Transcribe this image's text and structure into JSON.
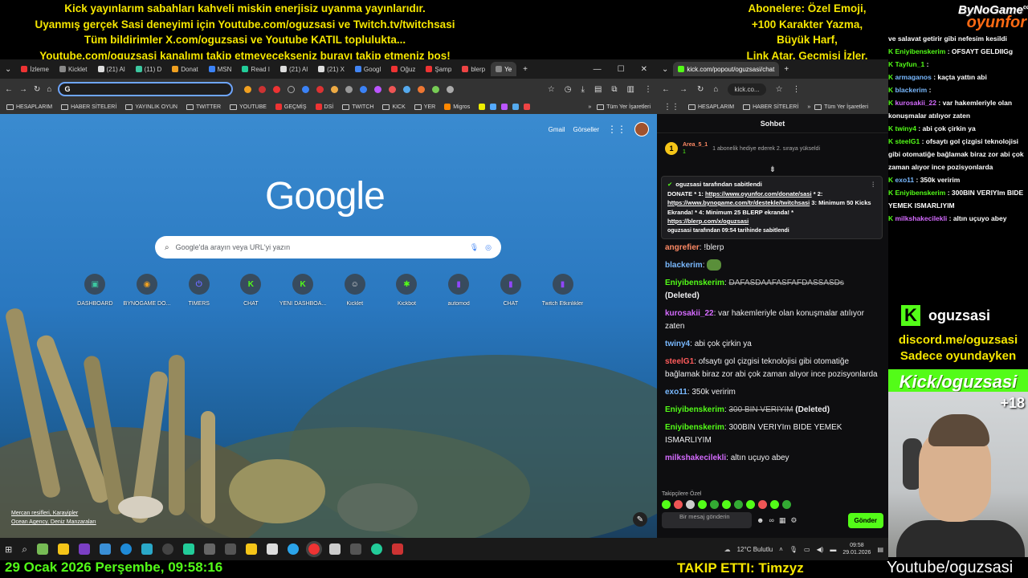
{
  "overlay_top": {
    "lines": [
      "Kick yayınlarım sabahları kahveli miskin enerjisiz uyanma yayınlarıdır.",
      "Uyanmış gerçek Sasi deneyimi için Youtube.com/oguzsasi ve Twitch.tv/twitchsasi",
      "Tüm bildirimler X.com/oguzsasi ve Youtube KATIL toplulukta...",
      "Youtube.com/oguzsasi kanalımı takip etmeyecekseniz burayı takip etmeniz boş!"
    ],
    "right_lines": [
      "Abonelere: Özel Emoji,",
      "+100 Karakter Yazma,",
      "Büyük Harf,",
      "Link Atar, Geçmişi İzler."
    ]
  },
  "brand": {
    "line1": "ByNoGame",
    "line2": "oyunfor",
    "suffix": "com"
  },
  "browser_main": {
    "tabs": [
      "İzleme",
      "Kicklet",
      "(21) Al",
      "(11) D",
      "Donat",
      "MSN",
      "Read I",
      "(21) Al",
      "(21) X",
      "Googl",
      "Oğuz",
      "Şamp",
      "blerp",
      "Ye"
    ],
    "address": "G",
    "bookmarks": [
      "HESAPLARIM",
      "HABER SİTELERİ",
      "YAYINLIK OYUN",
      "TWITTER",
      "YOUTUBE",
      "GEÇMİŞ",
      "DSİ",
      "TWITCH",
      "KICK",
      "YER",
      "Migros",
      "Tüm Yer İşaretleri"
    ],
    "top_links": [
      "Gmail",
      "Görseller"
    ],
    "logo": "Google",
    "search_placeholder": "Google'da arayın veya URL'yi yazın",
    "shortcuts": [
      {
        "label": "DASHBOARD",
        "glyph": "▣",
        "color": "#3cc7a0"
      },
      {
        "label": "BYNOGAME DO...",
        "glyph": "◉",
        "color": "#f0a020"
      },
      {
        "label": "TIMERS",
        "glyph": "⏻",
        "color": "#6b6bff"
      },
      {
        "label": "CHAT",
        "glyph": "K",
        "color": "#53fc18"
      },
      {
        "label": "YENİ DASHBOA...",
        "glyph": "K",
        "color": "#53fc18"
      },
      {
        "label": "Kicklet",
        "glyph": "☺",
        "color": "#ddd"
      },
      {
        "label": "Kickbot",
        "glyph": "✱",
        "color": "#53fc18"
      },
      {
        "label": "automod",
        "glyph": "▮",
        "color": "#9146ff"
      },
      {
        "label": "CHAT",
        "glyph": "▮",
        "color": "#9146ff"
      },
      {
        "label": "Twitch Etkinlikler",
        "glyph": "▮",
        "color": "#9146ff"
      }
    ],
    "credit_line1": "Mercan resifleri, Karayipler",
    "credit_line2": "Ocean Agency, Deniz Manzaraları"
  },
  "browser_chat": {
    "tab": "kick.com/popout/oguzsasi/chat",
    "address": "kick.co...",
    "bookmarks": [
      "HESAPLARIM",
      "HABER SİTELERİ",
      "Tüm Yer İşaretleri"
    ],
    "header": "Sohbet",
    "gift_user": "Area_5_1",
    "gift_count": "1",
    "gift_text": "1 abonelik hediye ederek 2. sıraya yükseldi",
    "pinned_by": "oguzsasi tarafından sabitlendi",
    "pinned_pre": "DONATE * 1: ",
    "pinned_link1": "https://www.oyunfor.com/donate/sasi",
    "pinned_mid1": " * 2: ",
    "pinned_link2": "https://www.bynogame.com/tr/destekle/twitchsasi",
    "pinned_mid2": " 3: Minimum 50 Kicks Ekranda! * 4: Minimum 25 BLERP ekranda! * ",
    "pinned_link3": "https://blerp.com/x/oguzsasi",
    "pinned_footer": "oguzsasi tarafından 09:54 tarihinde sabitlendi",
    "messages": [
      {
        "user": "angrefier",
        "color": "#ff8a65",
        "text": "!blerp",
        "deleted": false
      },
      {
        "user": "blackerim",
        "color": "#79b9ff",
        "text": "",
        "deleted": false
      },
      {
        "user": "Eniyibenskerim",
        "color": "#53fc18",
        "text": "DAFASDAAFASFAFDASSASDs",
        "deleted": true,
        "deleted_label": "(Deleted)"
      },
      {
        "user": "kurosakii_22",
        "color": "#d56bff",
        "text": "var hakemleriyle olan konuşmalar atılıyor zaten",
        "deleted": false
      },
      {
        "user": "twiny4",
        "color": "#79b9ff",
        "text": "abi çok çirkin ya",
        "deleted": false
      },
      {
        "user": "steelG1",
        "color": "#ff5b5b",
        "text": "ofsaytı gol çizgisi teknolojisi gibi otomatiğe bağlamak biraz zor abi çok zaman alıyor ince pozisyonlarda",
        "deleted": false
      },
      {
        "user": "exo11",
        "color": "#79b9ff",
        "text": "350k veririm",
        "deleted": false
      },
      {
        "user": "Eniyibenskerim",
        "color": "#53fc18",
        "text": "300 BIN VERIYIM",
        "deleted": true,
        "deleted_label": "(Deleted)"
      },
      {
        "user": "Eniyibenskerim",
        "color": "#53fc18",
        "text": "300BIN VERIYIm BIDE YEMEK ISMARLIYIM",
        "deleted": false
      },
      {
        "user": "milkshakecilekli",
        "color": "#d56bff",
        "text": "altın uçuyo abey",
        "deleted": false
      }
    ],
    "followers_label": "Takipçilere Özel",
    "input_placeholder": "Bir mesaj gönderin",
    "send_label": "Gönder"
  },
  "side_chat": [
    {
      "user": "",
      "text": "ve salavat getirir gibi nefesim kesildi",
      "cls": "k"
    },
    {
      "user": "Eniyibenskerim",
      "text": ": OFSAYT GELDIIGg",
      "cls": "g"
    },
    {
      "user": "Tayfun_1",
      "text": ":",
      "cls": "k"
    },
    {
      "user": "armaganos",
      "text": ": kaçta yattın abi",
      "cls": "b"
    },
    {
      "user": "blackerim",
      "text": ":",
      "cls": "b"
    },
    {
      "user": "kurosakii_22",
      "text": ": var hakemleriyle olan konuşmalar atılıyor zaten",
      "cls": "p"
    },
    {
      "user": "twiny4",
      "text": ": abi çok çirkin ya",
      "cls": "g"
    },
    {
      "user": "steelG1",
      "text": ": ofsaytı gol çizgisi teknolojisi gibi otomatiğe bağlamak biraz zor abi çok zaman alıyor ince pozisyonlarda",
      "cls": "g"
    },
    {
      "user": "exo11",
      "text": ": 350k veririm",
      "cls": "b"
    },
    {
      "user": "Eniyibenskerim",
      "text": ": 300BIN VERIYIm BIDE YEMEK ISMARLIYIM",
      "cls": "g"
    },
    {
      "user": "milkshakecilekli",
      "text": ": altın uçuyo abey",
      "cls": "p"
    }
  ],
  "social": {
    "kick_name": "oguzsasi",
    "discord": "discord.me/oguzsasi",
    "only_gaming": "Sadece oyundayken",
    "kick_url": "Kick/oguzsasi",
    "age": "+18"
  },
  "taskbar": {
    "weather": "12°C Bulutlu",
    "time": "09:58",
    "date": "29.01.2026"
  },
  "overlay_bottom": {
    "date_text": "29 Ocak 2026 Perşembe, 09:58:16",
    "follow_text": "TAKIP ETTI: Timzyz",
    "yt_text": "Youtube/oguzsasi"
  }
}
